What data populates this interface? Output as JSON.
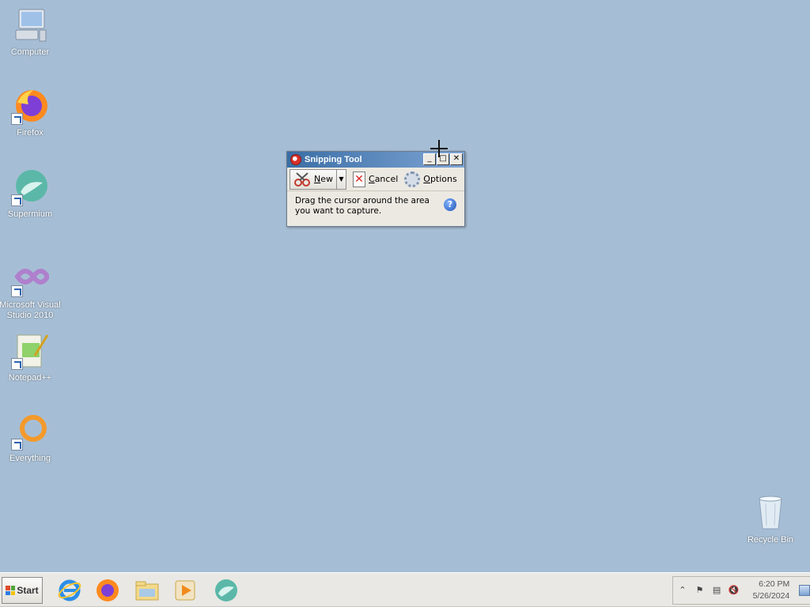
{
  "desktop": {
    "background": "#a6bed5",
    "icons": [
      {
        "label": "Computer",
        "icon": "computer-icon",
        "shortcut": false
      },
      {
        "label": "Firefox",
        "icon": "firefox-icon",
        "shortcut": true
      },
      {
        "label": "Supermium",
        "icon": "supermium-icon",
        "shortcut": true
      },
      {
        "label": "Microsoft Visual Studio 2010",
        "icon": "visual-studio-icon",
        "shortcut": true
      },
      {
        "label": "Notepad++",
        "icon": "notepad-plus-plus-icon",
        "shortcut": true
      },
      {
        "label": "Everything",
        "icon": "everything-search-icon",
        "shortcut": true
      },
      {
        "label": "Recycle Bin",
        "icon": "recycle-bin-icon",
        "shortcut": false
      }
    ]
  },
  "snipping_tool": {
    "title": "Snipping Tool",
    "buttons": {
      "minimize": "_",
      "maximize": "□",
      "close": "✕"
    },
    "toolbar": {
      "new_prefix": "N",
      "new_rest": "ew",
      "cancel_prefix": "C",
      "cancel_rest": "ancel",
      "options_prefix": "O",
      "options_rest": "ptions"
    },
    "message": "Drag the cursor around the area you want to capture.",
    "help": "?"
  },
  "taskbar": {
    "start_label": "Start",
    "pinned": [
      "internet-explorer-icon",
      "firefox-icon",
      "file-explorer-icon",
      "media-player-icon",
      "supermium-icon"
    ],
    "clock_time": "6:20 PM",
    "clock_date": "5/26/2024",
    "tray_icons": [
      "show-hidden-icons-chevron",
      "action-center-flag-icon",
      "network-icon",
      "volume-muted-icon"
    ]
  }
}
